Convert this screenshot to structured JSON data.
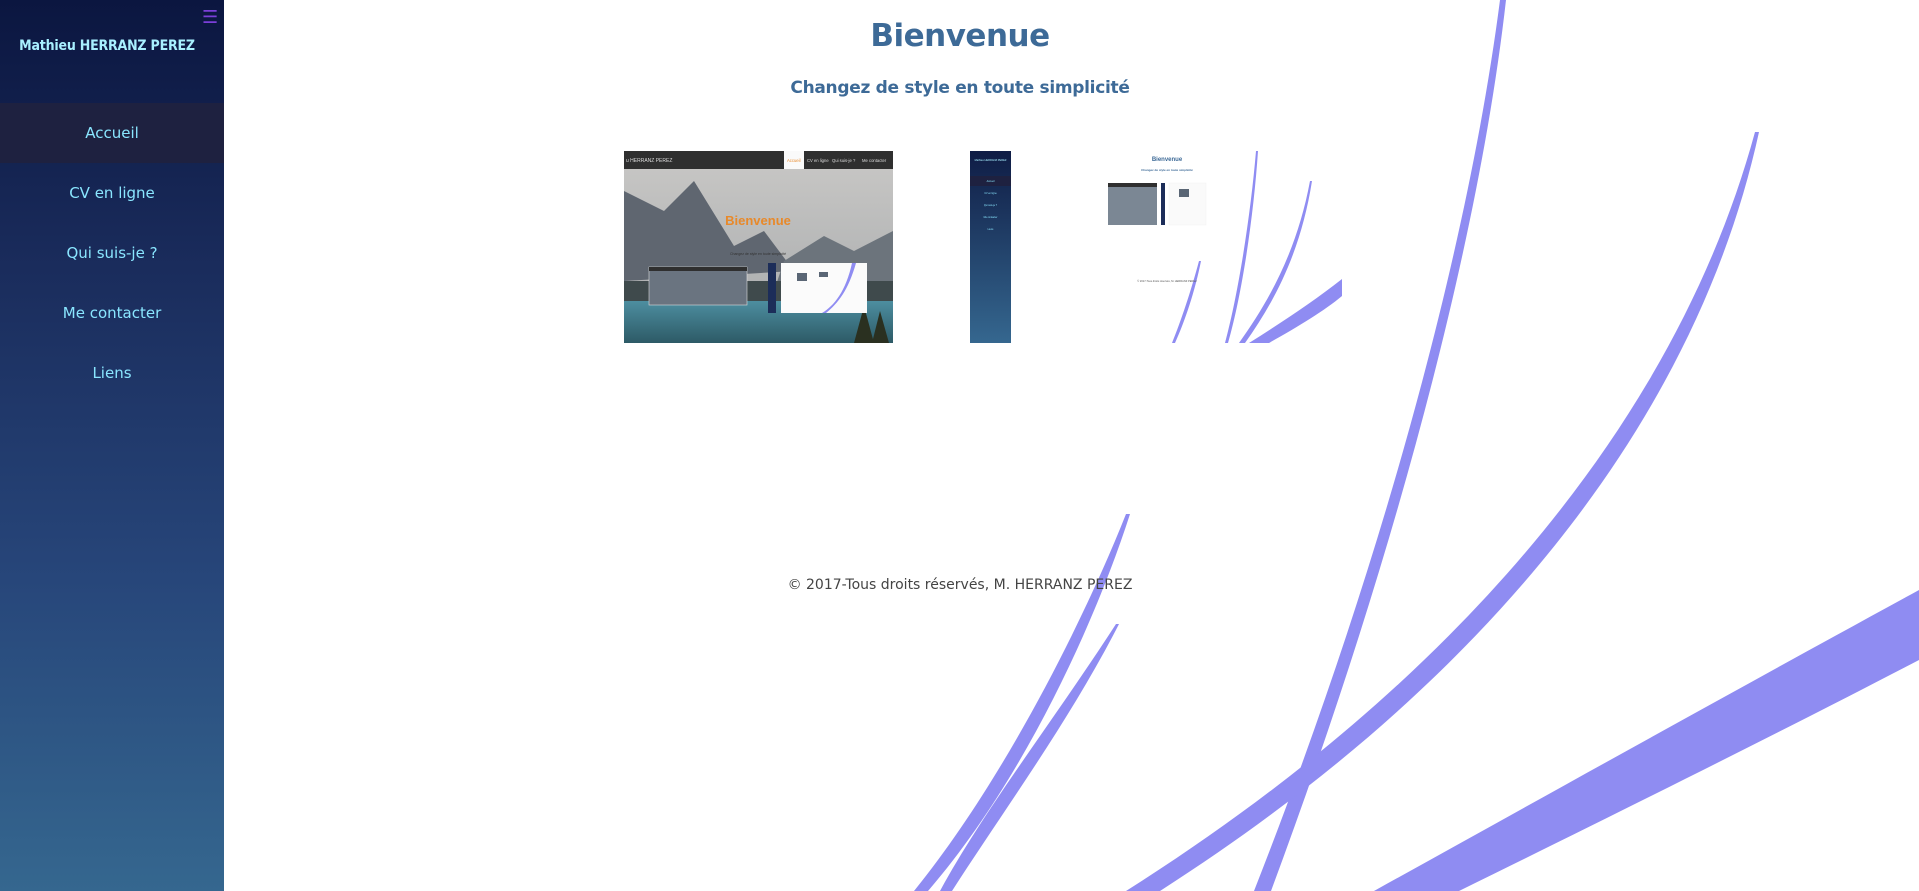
{
  "sidebar": {
    "site_name": "Mathieu HERRANZ PEREZ",
    "menu_icon": "hamburger-icon",
    "items": [
      {
        "label": "Accueil",
        "active": true
      },
      {
        "label": "CV en ligne",
        "active": false
      },
      {
        "label": "Qui suis-je ?",
        "active": false
      },
      {
        "label": "Me contacter",
        "active": false
      },
      {
        "label": "Liens",
        "active": false
      }
    ]
  },
  "main": {
    "title": "Bienvenue",
    "subtitle": "Changez de style en toute simplicité",
    "footer": "© 2017-Tous droits réservés, M. HERRANZ PEREZ"
  },
  "style_previews": {
    "theme1": {
      "site_name": "u HERRANZ PEREZ",
      "nav": [
        "Accueil",
        "CV en ligne",
        "Qui suis-je ?",
        "Me contacter"
      ],
      "title": "Bienvenue",
      "subtitle": "Changez de style en toute simplicité"
    },
    "theme2": {
      "site_name": "Mathieu HERRANZ PEREZ",
      "nav": [
        "Accueil",
        "CV en ligne",
        "Qui suis-je ?",
        "Me contacter",
        "Liens"
      ]
    },
    "theme3": {
      "title": "Bienvenue",
      "subtitle": "Changez de style en toute simplicité",
      "footer": "© 2017-Tous droits réservés, M. HERRANZ PEREZ"
    }
  },
  "colors": {
    "sidebar_text": "#9ee8ff",
    "heading": "#3d6a97",
    "swoosh": "#8f8cf2",
    "active_nav_bg": "#1e2140",
    "accent_orange": "#e8892a"
  }
}
